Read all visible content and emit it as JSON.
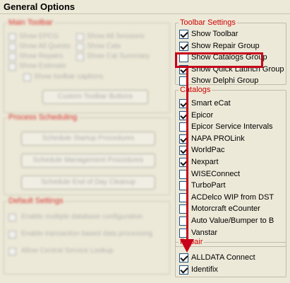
{
  "window": {
    "title": "General Options"
  },
  "left_panel": {
    "group1_legend": "Main Toolbar",
    "group1_items": [
      "Show EPCG",
      "Show All Quests",
      "Show Repairs",
      "Show Estimate",
      "Show toolbar captions",
      "Show All Sessions",
      "Show Cats",
      "Show Cat Summary"
    ],
    "group1_button": "Custom Toolbar Buttons",
    "group2_legend": "Process Scheduling",
    "group2_buttons": [
      "Schedule Startup Procedures",
      "Schedule Management Procedures",
      "Schedule End of Day Cleanup"
    ],
    "group3_legend": "Default Settings",
    "group3_items": [
      "Enable multiple database configuration",
      "Enable transaction based data processing",
      "Allow Central Service Lookup"
    ]
  },
  "toolbar_settings": {
    "legend": "Toolbar Settings",
    "items": [
      {
        "label": "Show Toolbar",
        "checked": true
      },
      {
        "label": "Show Repair Group",
        "checked": true
      },
      {
        "label": "Show Catalogs Group",
        "checked": false
      },
      {
        "label": "Show Quick Launch Group",
        "checked": true
      },
      {
        "label": "Show Delphi Group",
        "checked": false
      }
    ]
  },
  "catalogs": {
    "legend": "Catalogs",
    "items": [
      {
        "label": "Smart eCat",
        "checked": true
      },
      {
        "label": "Epicor",
        "checked": true
      },
      {
        "label": "Epicor Service Intervals",
        "checked": false
      },
      {
        "label": "NAPA PROLink",
        "checked": true
      },
      {
        "label": "WorldPac",
        "checked": true
      },
      {
        "label": "Nexpart",
        "checked": true
      },
      {
        "label": "WISEConnect",
        "checked": false
      },
      {
        "label": "TurboPart",
        "checked": false
      },
      {
        "label": "ACDelco WIP from DST",
        "checked": false
      },
      {
        "label": "Motorcraft eCounter",
        "checked": false
      },
      {
        "label": "Auto Value/Bumper to B",
        "checked": false
      },
      {
        "label": "Vanstar",
        "checked": false
      }
    ]
  },
  "repair": {
    "legend": "Repair",
    "items": [
      {
        "label": "ALLDATA Connect",
        "checked": true
      },
      {
        "label": "Identifix",
        "checked": true
      }
    ]
  },
  "annotation": {
    "color": "#c8001a"
  }
}
